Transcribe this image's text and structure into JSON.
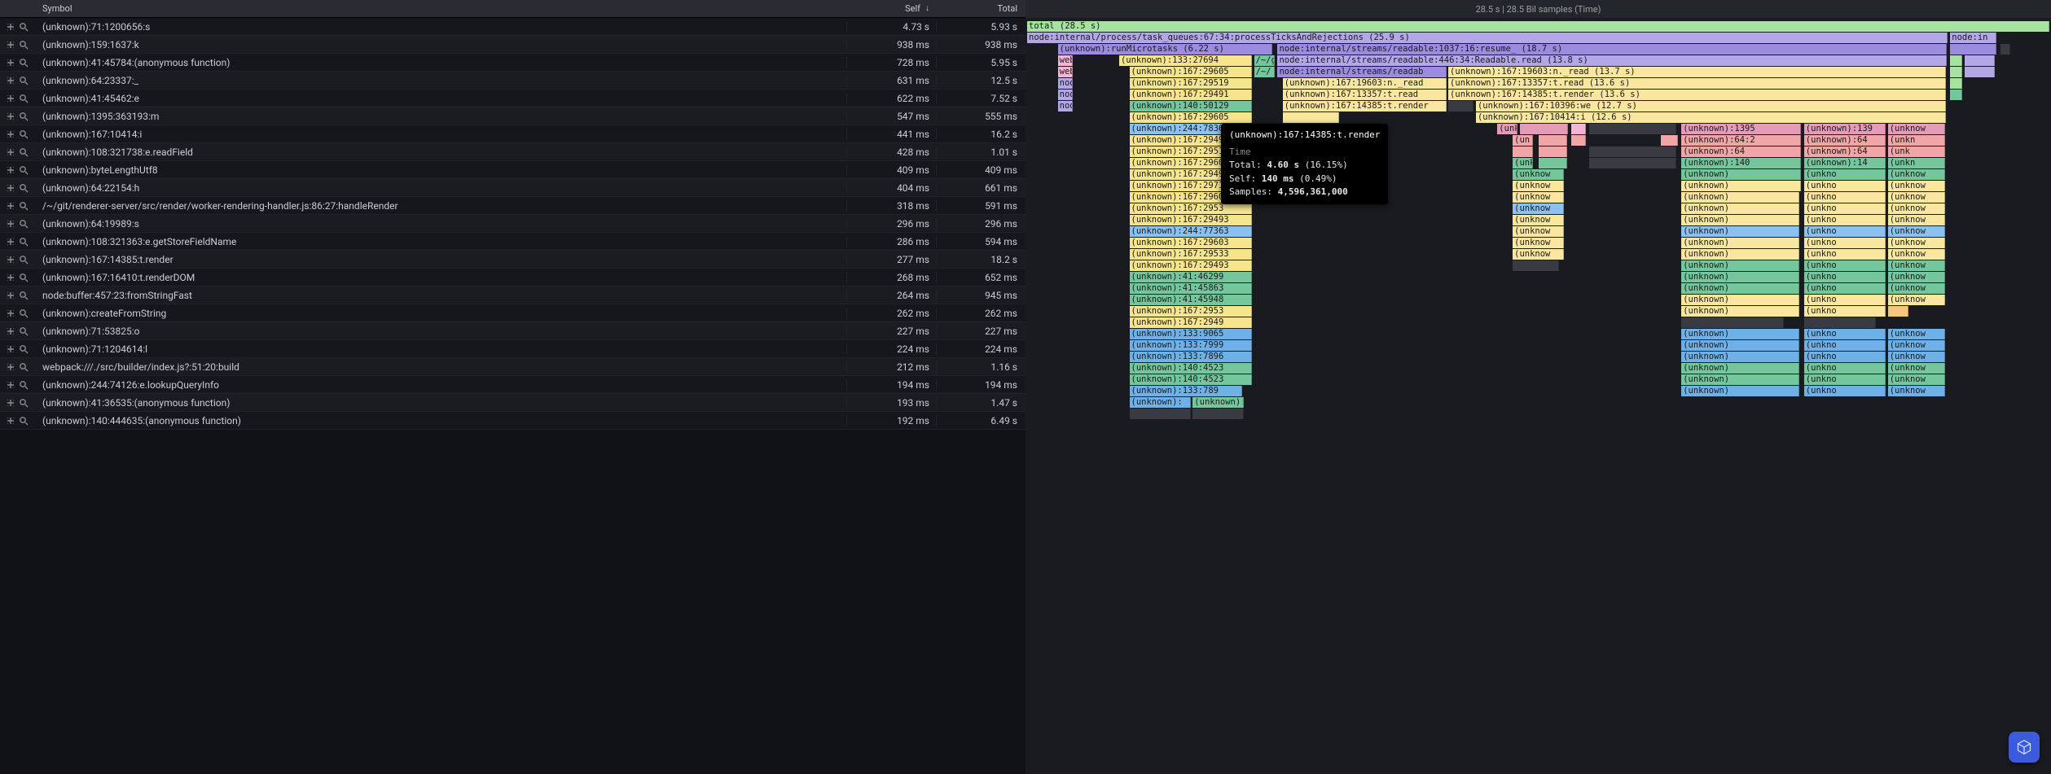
{
  "table": {
    "columns": {
      "symbol": "Symbol",
      "self": "Self",
      "total": "Total"
    },
    "sort_indicator": "↓",
    "rows": [
      {
        "symbol": "(unknown):71:1200656:s",
        "self": "4.73 s",
        "total": "5.93 s"
      },
      {
        "symbol": "(unknown):159:1637:k",
        "self": "938 ms",
        "total": "938 ms"
      },
      {
        "symbol": "(unknown):41:45784:(anonymous function)",
        "self": "728 ms",
        "total": "5.95 s"
      },
      {
        "symbol": "(unknown):64:23337:_",
        "self": "631 ms",
        "total": "12.5 s"
      },
      {
        "symbol": "(unknown):41:45462:e",
        "self": "622 ms",
        "total": "7.52 s"
      },
      {
        "symbol": "(unknown):1395:363193:m",
        "self": "547 ms",
        "total": "555 ms"
      },
      {
        "symbol": "(unknown):167:10414:i",
        "self": "441 ms",
        "total": "16.2 s"
      },
      {
        "symbol": "(unknown):108:321738:e.readField",
        "self": "428 ms",
        "total": "1.01 s"
      },
      {
        "symbol": "(unknown):byteLengthUtf8",
        "self": "409 ms",
        "total": "409 ms"
      },
      {
        "symbol": "(unknown):64:22154:h",
        "self": "404 ms",
        "total": "661 ms"
      },
      {
        "symbol": "/~/git/renderer-server/src/render/worker-rendering-handler.js:86:27:handleRender",
        "self": "318 ms",
        "total": "591 ms"
      },
      {
        "symbol": "(unknown):64:19989:s",
        "self": "296 ms",
        "total": "296 ms"
      },
      {
        "symbol": "(unknown):108:321363:e.getStoreFieldName",
        "self": "286 ms",
        "total": "594 ms"
      },
      {
        "symbol": "(unknown):167:14385:t.render",
        "self": "277 ms",
        "total": "18.2 s"
      },
      {
        "symbol": "(unknown):167:16410:t.renderDOM",
        "self": "268 ms",
        "total": "652 ms"
      },
      {
        "symbol": "node:buffer:457:23:fromStringFast",
        "self": "264 ms",
        "total": "945 ms"
      },
      {
        "symbol": "(unknown):createFromString",
        "self": "262 ms",
        "total": "262 ms"
      },
      {
        "symbol": "(unknown):71:53825:o",
        "self": "227 ms",
        "total": "227 ms"
      },
      {
        "symbol": "(unknown):71:1204614:l",
        "self": "224 ms",
        "total": "224 ms"
      },
      {
        "symbol": "webpack:///./src/builder/index.js?:51:20:build",
        "self": "212 ms",
        "total": "1.16 s"
      },
      {
        "symbol": "(unknown):244:74126:e.lookupQueryInfo",
        "self": "194 ms",
        "total": "194 ms"
      },
      {
        "symbol": "(unknown):41:36535:(anonymous function)",
        "self": "193 ms",
        "total": "1.47 s"
      },
      {
        "symbol": "(unknown):140:444635:(anonymous function)",
        "self": "192 ms",
        "total": "6.49 s"
      }
    ]
  },
  "right": {
    "header": "28.5 s | 28.5 Bil samples (Time)",
    "tooltip": {
      "name": "(unknown):167:14385:t.render",
      "section": "Time",
      "total_label": "Total:",
      "total": "4.60 s",
      "total_pct": "(16.15%)",
      "self_label": "Self:",
      "self": "140 ms",
      "self_pct": "(0.49%)",
      "samples_label": "Samples:",
      "samples": "4,596,361,000"
    },
    "flame": {
      "root": "total (28.5 s)",
      "r1_a": "node:internal/process/task_queues:67:34:processTicksAndRejections (25.9 s)",
      "r1_b": "node:in",
      "r2_a": "(unknown):runMicrotasks (6.22 s)",
      "r2_b": "node:internal/streams/readable:1037:16:resume_ (18.7 s)",
      "r3_a": "(unknown):133:27694",
      "r3_b": "/~/gi",
      "r3_c": "node:internal/streams/readable:446:34:Readable.read (13.8 s)",
      "r4_w1": "webpac",
      "r4_a": "(unknown):167:29605",
      "r4_b": "/~/",
      "r4_c": "node:internal/streams/readab",
      "r4_d": "(unknown):167:19603:n._read (13.7 s)",
      "r5_w1": "webp",
      "r5_a": "(unknown):167:29519",
      "r5_b": "(unknown):167:19603:n._read",
      "r5_c": "(unknown):167:13357:t.read (13.6 s)",
      "r6_w1": "node",
      "r6_a": "(unknown):167:29491",
      "r6_b": "(unknown):167:13357:t.read",
      "r6_c": "(unknown):167:14385:t.render (13.6 s)",
      "r7_w1": "node",
      "r7_a": "(unknown):140:50129",
      "r7_b": "(unknown):167:14385:t.render",
      "r7_c": "(unknown):167:10396:we (12.7 s)",
      "r8_w1": "node",
      "r8_a": "(unknown):167:29605",
      "r8_c": "(unknown):167:10414:i (12.6 s)",
      "r9_a": "(unknown):244:78363",
      "r9_t1": "(unkn",
      "r9_t1b": "(unknown):1395",
      "r9_t1c": "(unknown):139",
      "r9_t1d": "(unknow",
      "r10_a": "(unknown):167:29493",
      "r10_t1": "(un",
      "r10_t2": "(unknown):64:2",
      "r10_t3": "(unknown):64",
      "r10_t4": "(unkn",
      "r11_a": "(unknown):167:29519",
      "r11_t2": "(unknown):64",
      "r11_t3": "(unknown):64",
      "r11_t4": "(unk",
      "r12_a": "(unknown):167:29605",
      "r12_t": "(unkn",
      "r12_t2": "(unknown):140",
      "r12_t3": "(unknown):14",
      "r12_t4": "(unkn",
      "r13_a": "(unknown):167:29493",
      "r14_a": "(unknown):167:29713",
      "r15_a": "(unknown):167:29603",
      "r16_a": "(unknown):167:2953",
      "r17_a": "(unknown):167:29493",
      "r18_a": "(unknown):244:77363",
      "r19_a": "(unknown):167:29603",
      "r20_a": "(unknown):167:29533",
      "r21_a": "(unknown):167:29493",
      "r22_a": "(unknown):41:46299",
      "r23_a": "(unknown):41:45863",
      "r24_a": "(unknown):41:45948",
      "r25_a": "(unknown):167:2953",
      "r26_a": "(unknown):167:2949",
      "r27_a": "(unknown):133:9065",
      "r28_a": "(unknown):133:7999",
      "r29_a": "(unknown):133:7896",
      "r30_a": "(unknown):140:4523",
      "r31_a": "(unknown):140:4523",
      "r32_a": "(unknown):133:789",
      "r33_a": "(unknown):",
      "r34_a": "(unknown):",
      "gen_unk": "(unknow",
      "gen_unk2": "(unkno",
      "gen_unk3": "(unknown)"
    }
  }
}
